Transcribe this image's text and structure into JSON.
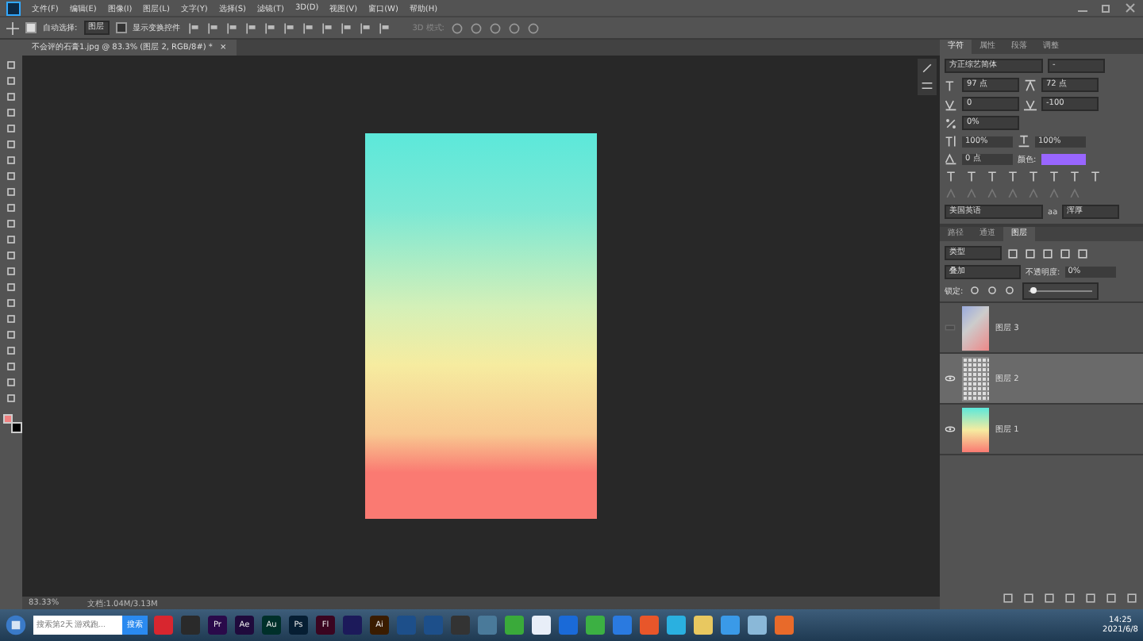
{
  "menu": [
    "文件(F)",
    "编辑(E)",
    "图像(I)",
    "图层(L)",
    "文字(Y)",
    "选择(S)",
    "滤镜(T)",
    "3D(D)",
    "视图(V)",
    "窗口(W)",
    "帮助(H)"
  ],
  "options": {
    "auto_select": {
      "label": "自动选择:",
      "checked": true
    },
    "target": "图层",
    "transform": {
      "label": "显示变换控件",
      "checked": false
    },
    "mode_label": "3D 模式:"
  },
  "document_tab": {
    "title": "不会评的石膏1.jpg @ 83.3% (图层 2, RGB/8#) *",
    "close": "×"
  },
  "character_panel": {
    "tabs": [
      {
        "label": "字符",
        "selected": true
      },
      {
        "label": "属性",
        "selected": false
      },
      {
        "label": "段落",
        "selected": false
      },
      {
        "label": "调整",
        "selected": false
      }
    ],
    "font_family": "方正综艺简体",
    "font_style": "-",
    "size": "97 点",
    "leading": "72 点",
    "kerning": "0",
    "tracking": "-100",
    "vscale": "0%",
    "vertical": "100%",
    "horizontal": "100%",
    "baseline": "0 点",
    "color_label": "颜色:",
    "color": "#9966ff",
    "language": "美国英语",
    "aa": "aa",
    "antialias": "浑厚"
  },
  "layers_panel": {
    "tabs": [
      {
        "label": "路径",
        "selected": false
      },
      {
        "label": "通道",
        "selected": false
      },
      {
        "label": "图层",
        "selected": true
      }
    ],
    "filter": "类型",
    "blend": "叠加",
    "opacity_label": "不透明度:",
    "opacity": "0%",
    "opacity_slider": {
      "level": 0.02
    },
    "lock_label": "锁定:",
    "layers": [
      {
        "name": "图层 3",
        "kind": "photo",
        "visible": false,
        "selected": false
      },
      {
        "name": "图层 2",
        "kind": "grid",
        "visible": true,
        "selected": true
      },
      {
        "name": "图层 1",
        "kind": "gradient",
        "visible": true,
        "selected": false
      }
    ]
  },
  "status_bar": {
    "zoom": "83.33%",
    "doc": "文档:1.04M/3.13M"
  },
  "taskbar": {
    "search_placeholder": "搜索第2天 游戏跑...",
    "search_button": "搜索",
    "apps": [
      {
        "color": "#d8262f"
      },
      {
        "color": "#2a2a2a"
      },
      {
        "label": "Pr",
        "color": "#2a0a4a"
      },
      {
        "label": "Ae",
        "color": "#1f0a3c"
      },
      {
        "label": "Au",
        "color": "#00302a"
      },
      {
        "label": "Ps",
        "color": "#061e33"
      },
      {
        "label": "Fl",
        "color": "#3a0520"
      },
      {
        "color": "#1c1a5a"
      },
      {
        "label": "Ai",
        "color": "#3a1c00"
      },
      {
        "color": "#1d4f8a"
      },
      {
        "color": "#1d4f8a"
      },
      {
        "color": "#333333"
      },
      {
        "color": "#4a7a9a"
      },
      {
        "color": "#3aaa3a"
      },
      {
        "color": "#e8eef8"
      },
      {
        "color": "#1a6ad8"
      },
      {
        "color": "#3cb043"
      },
      {
        "color": "#2a7ae0"
      },
      {
        "color": "#e8562a"
      },
      {
        "color": "#2ab0e0"
      },
      {
        "color": "#e8c860"
      },
      {
        "color": "#3a9ae8"
      },
      {
        "color": "#8ab8d8"
      },
      {
        "color": "#e86a2a"
      }
    ],
    "time": "14:25",
    "date": "2021/6/8"
  }
}
